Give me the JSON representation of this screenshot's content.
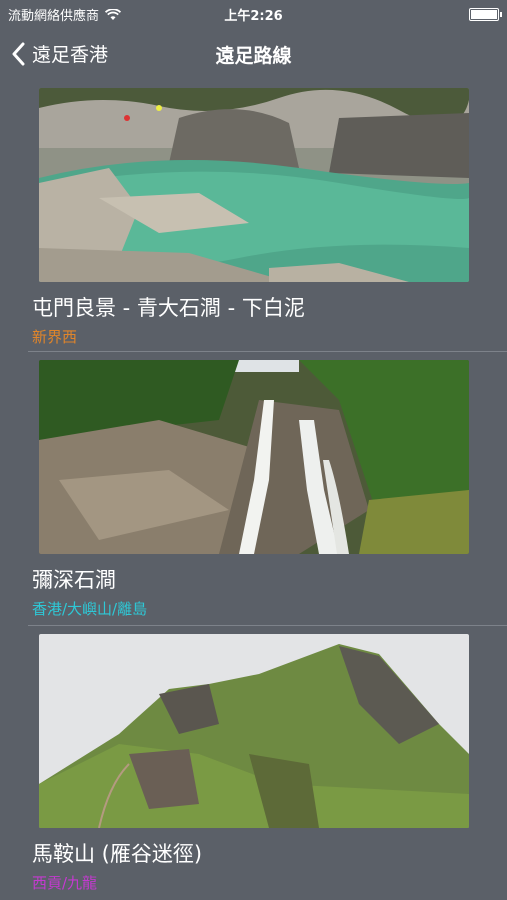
{
  "status": {
    "carrier": "流動網絡供應商",
    "time": "上午2:26"
  },
  "nav": {
    "back_label": "遠足香港",
    "title": "遠足路線"
  },
  "routes": [
    {
      "title": "屯門良景 - 青大石澗 - 下白泥",
      "region": "新界西",
      "region_color": "#e0852a"
    },
    {
      "title": "彌深石澗",
      "region": "香港/大嶼山/離島",
      "region_color": "#2ec8d6"
    },
    {
      "title": "馬鞍山 (雁谷迷徑)",
      "region": "西貢/九龍",
      "region_color": "#c43ad0"
    }
  ]
}
